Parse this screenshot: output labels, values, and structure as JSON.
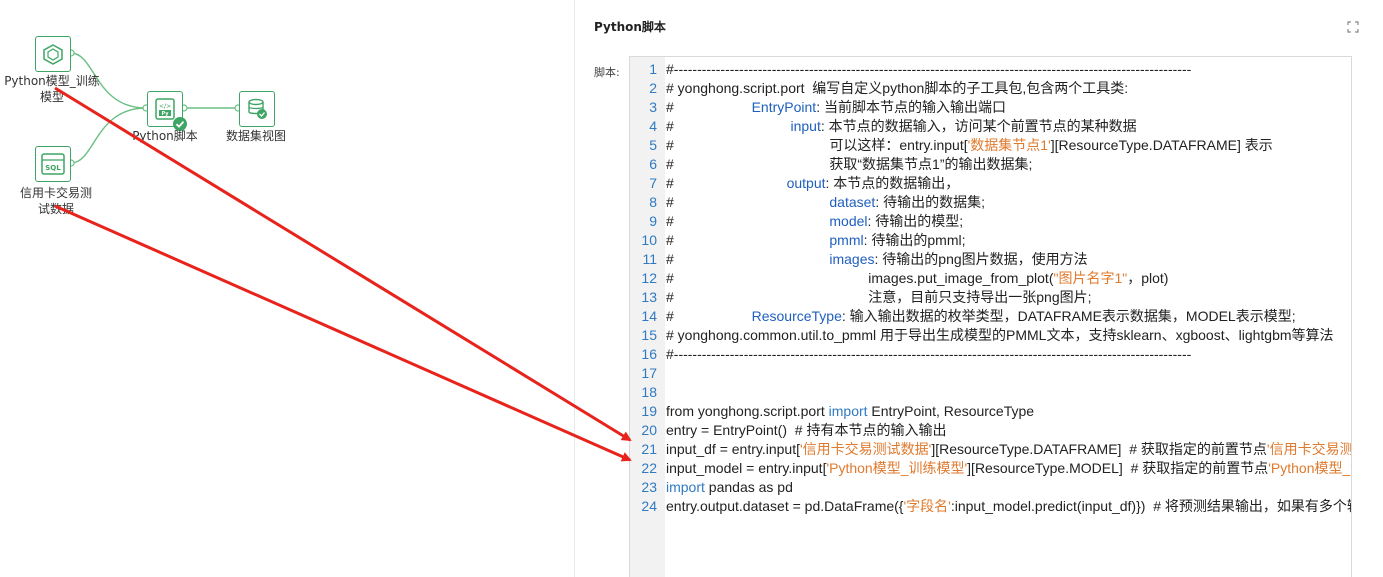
{
  "canvas": {
    "nodes": [
      {
        "id": "model",
        "label_lines": [
          "Python模型_训练",
          "模型"
        ],
        "icon": "python-model-icon"
      },
      {
        "id": "dataset",
        "label_lines": [
          "信用卡交易测",
          "试数据"
        ],
        "icon": "sql-icon"
      },
      {
        "id": "script",
        "label_lines": [
          "Python脚本"
        ],
        "icon": "python-script-icon",
        "status": "success"
      },
      {
        "id": "view",
        "label_lines": [
          "数据集视图"
        ],
        "icon": "dataset-view-icon"
      }
    ]
  },
  "panel": {
    "title": "Python脚本",
    "script_label": "脚本:",
    "lines": [
      [
        [
          "c",
          "#---------------------------------------------------------------------------------------------------------------"
        ]
      ],
      [
        [
          "c",
          "# yonghong.script.port  编写自定义python脚本的子工具包,包含两个工具类:"
        ]
      ],
      [
        [
          "c",
          "#                    "
        ],
        [
          "b",
          "EntryPoint"
        ],
        [
          "c",
          ": 当前脚本节点的输入输出端口"
        ]
      ],
      [
        [
          "c",
          "#                              "
        ],
        [
          "b",
          "input"
        ],
        [
          "c",
          ": 本节点的数据输入，访问某个前置节点的某种数据"
        ]
      ],
      [
        [
          "c",
          "#                                        可以这样：entry.input["
        ],
        [
          "s",
          "'数据集节点1'"
        ],
        [
          "c",
          "][ResourceType.DATAFRAME] 表示"
        ]
      ],
      [
        [
          "c",
          "#                                        获取“数据集节点1”的输出数据集;"
        ]
      ],
      [
        [
          "c",
          "#                             "
        ],
        [
          "b",
          "output"
        ],
        [
          "c",
          ": 本节点的数据输出，"
        ]
      ],
      [
        [
          "c",
          "#                                        "
        ],
        [
          "b",
          "dataset"
        ],
        [
          "c",
          ": 待输出的数据集;"
        ]
      ],
      [
        [
          "c",
          "#                                        "
        ],
        [
          "b",
          "model"
        ],
        [
          "c",
          ": 待输出的模型;"
        ]
      ],
      [
        [
          "c",
          "#                                        "
        ],
        [
          "b",
          "pmml"
        ],
        [
          "c",
          ": 待输出的pmml;"
        ]
      ],
      [
        [
          "c",
          "#                                        "
        ],
        [
          "b",
          "images"
        ],
        [
          "c",
          ": 待输出的png图片数据，使用方法"
        ]
      ],
      [
        [
          "c",
          "#                                                  images.put_image_from_plot("
        ],
        [
          "s",
          "\"图片名字1\""
        ],
        [
          "c",
          "，plot)"
        ]
      ],
      [
        [
          "c",
          "#                                                  注意，目前只支持导出一张png图片;"
        ]
      ],
      [
        [
          "c",
          "#                    "
        ],
        [
          "b",
          "ResourceType"
        ],
        [
          "c",
          ": 输入输出数据的枚举类型，DATAFRAME表示数据集，MODEL表示模型;"
        ]
      ],
      [
        [
          "c",
          "# yonghong.common.util.to_pmml 用于导出生成模型的PMML文本，支持sklearn、xgboost、lightgbm等算法"
        ]
      ],
      [
        [
          "c",
          "#---------------------------------------------------------------------------------------------------------------"
        ]
      ],
      [
        [
          "c",
          ""
        ]
      ],
      [
        [
          "c",
          ""
        ]
      ],
      [
        [
          "c",
          "from yonghong.script.port "
        ],
        [
          "k",
          "import"
        ],
        [
          "c",
          " EntryPoint, ResourceType"
        ]
      ],
      [
        [
          "c",
          "entry = EntryPoint()  # 持有本节点的输入输出"
        ]
      ],
      [
        [
          "c",
          "input_df = entry.input["
        ],
        [
          "s",
          "'信用卡交易测试数据'"
        ],
        [
          "c",
          "][ResourceType.DATAFRAME]  # 获取指定的前置节点"
        ],
        [
          "s",
          "'信用卡交易测试数据'"
        ]
      ],
      [
        [
          "c",
          "input_model = entry.input["
        ],
        [
          "s",
          "'Python模型_训练模型'"
        ],
        [
          "c",
          "][ResourceType.MODEL]  # 获取指定的前置节点"
        ],
        [
          "s",
          "'Python模型_训练模型'"
        ]
      ],
      [
        [
          "k",
          "import"
        ],
        [
          "c",
          " pandas as pd"
        ]
      ],
      [
        [
          "c",
          "entry.output.dataset = pd.DataFrame({"
        ],
        [
          "s",
          "'字段名'"
        ],
        [
          "c",
          ":input_model.predict(input_df)})  # 将预测结果输出，如果有多个输出"
        ]
      ]
    ]
  },
  "colors": {
    "accent": "#3fa564",
    "line_number": "#2f7ac2",
    "string": "#e07a2e",
    "arrow": "#e8231c"
  }
}
